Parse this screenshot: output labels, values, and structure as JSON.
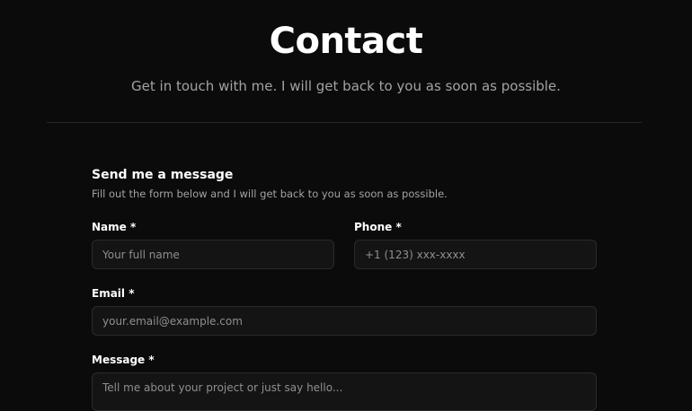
{
  "header": {
    "title": "Contact",
    "subtitle": "Get in touch with me. I will get back to you as soon as possible."
  },
  "form": {
    "heading": "Send me a message",
    "description": "Fill out the form below and I will get back to you as soon as possible.",
    "fields": {
      "name": {
        "label": "Name *",
        "placeholder": "Your full name",
        "value": ""
      },
      "phone": {
        "label": "Phone *",
        "placeholder": "+1 (123) xxx-xxxx",
        "value": ""
      },
      "email": {
        "label": "Email *",
        "placeholder": "your.email@example.com",
        "value": ""
      },
      "message": {
        "label": "Message *",
        "placeholder": "Tell me about your project or just say hello...",
        "value": ""
      }
    }
  },
  "colors": {
    "background": "#0b0b0b",
    "text_primary": "#ffffff",
    "text_muted": "#a3a3a3",
    "input_bg": "#141414",
    "input_border": "#2a2a2a",
    "divider": "#262626"
  }
}
